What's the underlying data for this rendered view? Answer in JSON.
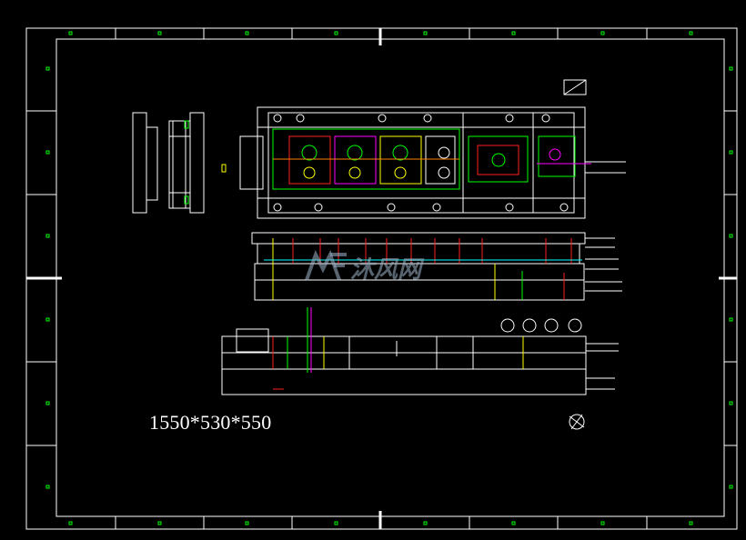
{
  "drawing": {
    "dimension_note": "1550*530*550",
    "watermark_text": "沐风网",
    "watermark_logo": "mf-logo-icon",
    "colors": {
      "background": "#000000",
      "frame": "#ffffff",
      "marker": "#00ff00",
      "part_green": "#00ff00",
      "part_red": "#ff2020",
      "part_yellow": "#ffff00",
      "part_magenta": "#ff00ff",
      "part_cyan": "#00ffff",
      "part_orange": "#ff8000"
    }
  }
}
